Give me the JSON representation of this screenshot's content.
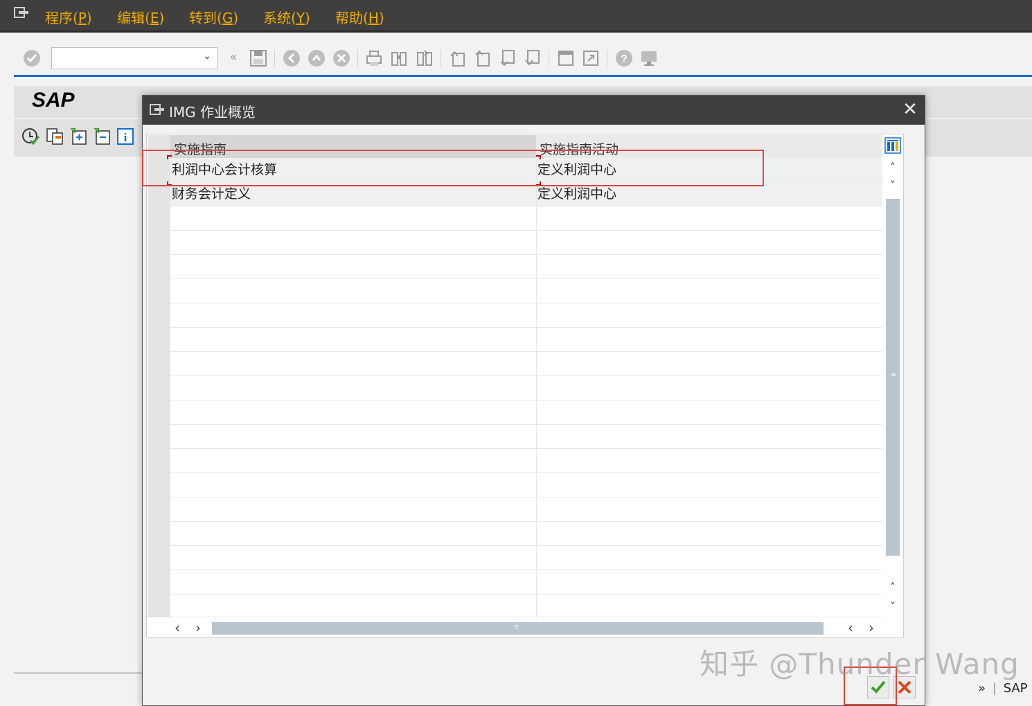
{
  "menubar": {
    "items": [
      "程序(P)",
      "编辑(E)",
      "转到(G)",
      "系统(Y)",
      "帮助(H)"
    ]
  },
  "toolbar": {
    "command_field_value": ""
  },
  "sap_logo": "SAP",
  "dialog": {
    "title": "IMG 作业概览",
    "columns": [
      "实施指南",
      "实施指南活动"
    ],
    "rows": [
      [
        "利润中心会计核算",
        "定义利润中心"
      ],
      [
        "财务会计定义",
        "定义利润中心"
      ]
    ]
  },
  "status_bar": {
    "right_text": "SAP"
  },
  "watermark": "知乎 @Thunder Wang",
  "colors": {
    "menubar_bg": "#3f3f3f",
    "menu_text": "#f0ab00",
    "accent_line": "#0a6ed1",
    "highlight_red": "#e0463b",
    "ok_green": "#3aa12f",
    "cancel_red": "#d9481c"
  },
  "icons": {
    "menu": "sap-menu-icon",
    "enter": "check-circle-icon",
    "save": "save-icon",
    "back": "back-icon",
    "exit": "exit-icon",
    "cancel": "cancel-icon",
    "print": "print-icon",
    "find": "find-icon",
    "find_next": "find-next-icon",
    "help": "help-icon",
    "layout": "customize-layout-icon"
  }
}
